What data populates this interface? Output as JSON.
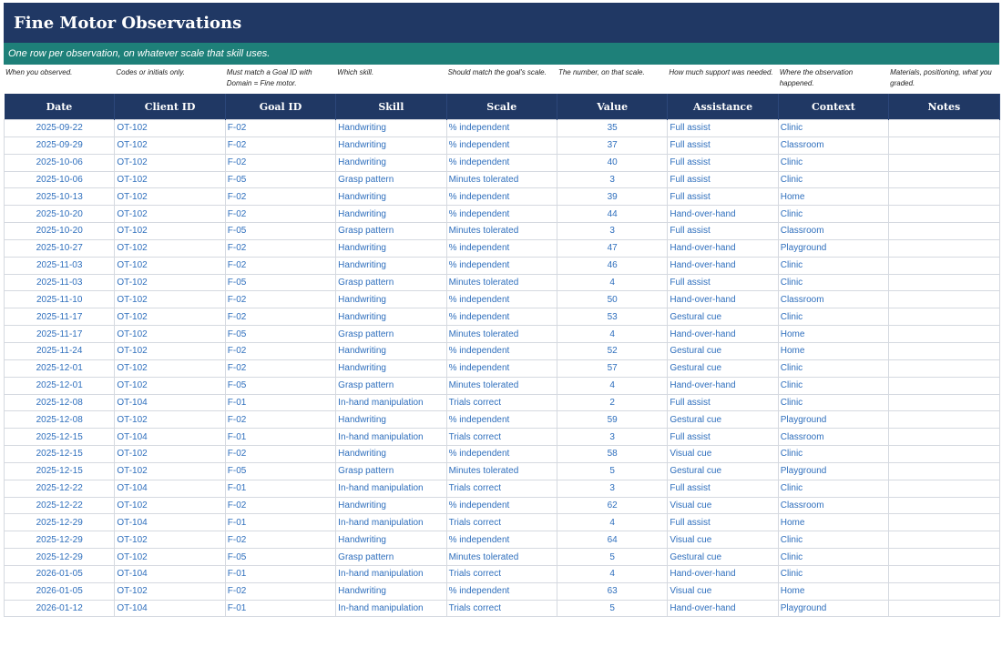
{
  "title": "Fine Motor Observations",
  "subtitle": "One row per observation, on whatever scale that skill uses.",
  "hints": [
    "When you observed.",
    "Codes or initials only.",
    "Must match a Goal ID with Domain = Fine motor.",
    "Which skill.",
    "Should match the goal's scale.",
    "The number, on that scale.",
    "How much support was needed.",
    "Where the observation happened.",
    "Materials, positioning, what you graded."
  ],
  "columns": [
    "Date",
    "Client ID",
    "Goal ID",
    "Skill",
    "Scale",
    "Value",
    "Assistance",
    "Context",
    "Notes"
  ],
  "rows": [
    [
      "2025-09-22",
      "OT-102",
      "F-02",
      "Handwriting",
      "% independent",
      "35",
      "Full assist",
      "Clinic",
      ""
    ],
    [
      "2025-09-29",
      "OT-102",
      "F-02",
      "Handwriting",
      "% independent",
      "37",
      "Full assist",
      "Classroom",
      ""
    ],
    [
      "2025-10-06",
      "OT-102",
      "F-02",
      "Handwriting",
      "% independent",
      "40",
      "Full assist",
      "Clinic",
      ""
    ],
    [
      "2025-10-06",
      "OT-102",
      "F-05",
      "Grasp pattern",
      "Minutes tolerated",
      "3",
      "Full assist",
      "Clinic",
      ""
    ],
    [
      "2025-10-13",
      "OT-102",
      "F-02",
      "Handwriting",
      "% independent",
      "39",
      "Full assist",
      "Home",
      ""
    ],
    [
      "2025-10-20",
      "OT-102",
      "F-02",
      "Handwriting",
      "% independent",
      "44",
      "Hand-over-hand",
      "Clinic",
      ""
    ],
    [
      "2025-10-20",
      "OT-102",
      "F-05",
      "Grasp pattern",
      "Minutes tolerated",
      "3",
      "Full assist",
      "Classroom",
      ""
    ],
    [
      "2025-10-27",
      "OT-102",
      "F-02",
      "Handwriting",
      "% independent",
      "47",
      "Hand-over-hand",
      "Playground",
      ""
    ],
    [
      "2025-11-03",
      "OT-102",
      "F-02",
      "Handwriting",
      "% independent",
      "46",
      "Hand-over-hand",
      "Clinic",
      ""
    ],
    [
      "2025-11-03",
      "OT-102",
      "F-05",
      "Grasp pattern",
      "Minutes tolerated",
      "4",
      "Full assist",
      "Clinic",
      ""
    ],
    [
      "2025-11-10",
      "OT-102",
      "F-02",
      "Handwriting",
      "% independent",
      "50",
      "Hand-over-hand",
      "Classroom",
      ""
    ],
    [
      "2025-11-17",
      "OT-102",
      "F-02",
      "Handwriting",
      "% independent",
      "53",
      "Gestural cue",
      "Clinic",
      ""
    ],
    [
      "2025-11-17",
      "OT-102",
      "F-05",
      "Grasp pattern",
      "Minutes tolerated",
      "4",
      "Hand-over-hand",
      "Home",
      ""
    ],
    [
      "2025-11-24",
      "OT-102",
      "F-02",
      "Handwriting",
      "% independent",
      "52",
      "Gestural cue",
      "Home",
      ""
    ],
    [
      "2025-12-01",
      "OT-102",
      "F-02",
      "Handwriting",
      "% independent",
      "57",
      "Gestural cue",
      "Clinic",
      ""
    ],
    [
      "2025-12-01",
      "OT-102",
      "F-05",
      "Grasp pattern",
      "Minutes tolerated",
      "4",
      "Hand-over-hand",
      "Clinic",
      ""
    ],
    [
      "2025-12-08",
      "OT-104",
      "F-01",
      "In-hand manipulation",
      "Trials correct",
      "2",
      "Full assist",
      "Clinic",
      ""
    ],
    [
      "2025-12-08",
      "OT-102",
      "F-02",
      "Handwriting",
      "% independent",
      "59",
      "Gestural cue",
      "Playground",
      ""
    ],
    [
      "2025-12-15",
      "OT-104",
      "F-01",
      "In-hand manipulation",
      "Trials correct",
      "3",
      "Full assist",
      "Classroom",
      ""
    ],
    [
      "2025-12-15",
      "OT-102",
      "F-02",
      "Handwriting",
      "% independent",
      "58",
      "Visual cue",
      "Clinic",
      ""
    ],
    [
      "2025-12-15",
      "OT-102",
      "F-05",
      "Grasp pattern",
      "Minutes tolerated",
      "5",
      "Gestural cue",
      "Playground",
      ""
    ],
    [
      "2025-12-22",
      "OT-104",
      "F-01",
      "In-hand manipulation",
      "Trials correct",
      "3",
      "Full assist",
      "Clinic",
      ""
    ],
    [
      "2025-12-22",
      "OT-102",
      "F-02",
      "Handwriting",
      "% independent",
      "62",
      "Visual cue",
      "Classroom",
      ""
    ],
    [
      "2025-12-29",
      "OT-104",
      "F-01",
      "In-hand manipulation",
      "Trials correct",
      "4",
      "Full assist",
      "Home",
      ""
    ],
    [
      "2025-12-29",
      "OT-102",
      "F-02",
      "Handwriting",
      "% independent",
      "64",
      "Visual cue",
      "Clinic",
      ""
    ],
    [
      "2025-12-29",
      "OT-102",
      "F-05",
      "Grasp pattern",
      "Minutes tolerated",
      "5",
      "Gestural cue",
      "Clinic",
      ""
    ],
    [
      "2026-01-05",
      "OT-104",
      "F-01",
      "In-hand manipulation",
      "Trials correct",
      "4",
      "Hand-over-hand",
      "Clinic",
      ""
    ],
    [
      "2026-01-05",
      "OT-102",
      "F-02",
      "Handwriting",
      "% independent",
      "63",
      "Visual cue",
      "Home",
      ""
    ],
    [
      "2026-01-12",
      "OT-104",
      "F-01",
      "In-hand manipulation",
      "Trials correct",
      "5",
      "Hand-over-hand",
      "Playground",
      ""
    ]
  ]
}
